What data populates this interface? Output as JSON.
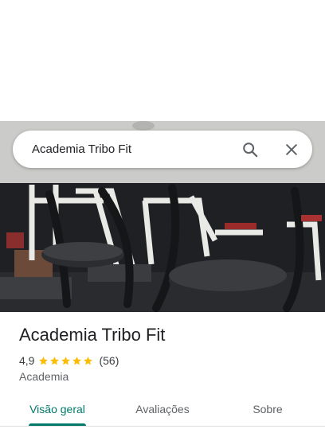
{
  "search": {
    "query": "Academia Tribo Fit",
    "search_icon": "search-icon",
    "close_icon": "close-icon"
  },
  "photo": {
    "subject": "gym-equipment-photo"
  },
  "place": {
    "title": "Academia Tribo Fit",
    "rating": "4,9",
    "stars": 5,
    "review_count": "(56)",
    "category": "Academia"
  },
  "tabs": [
    {
      "label": "Visão geral",
      "active": true
    },
    {
      "label": "Avaliações",
      "active": false
    },
    {
      "label": "Sobre",
      "active": false
    }
  ],
  "colors": {
    "accent": "#00796b",
    "star": "#fbbc04",
    "text_primary": "#202124",
    "text_secondary": "#5f6368"
  }
}
